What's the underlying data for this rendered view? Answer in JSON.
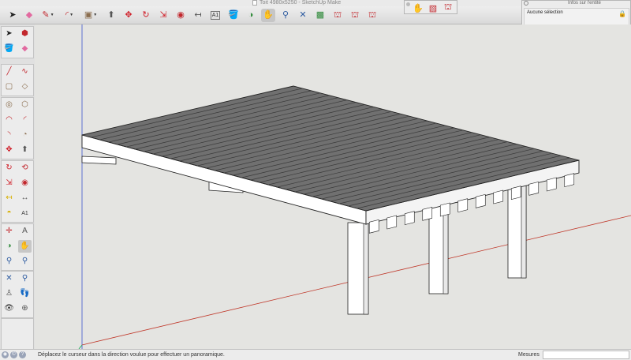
{
  "window": {
    "title": "Toit 4980x5250 - SketchUp Make"
  },
  "toolbar": {
    "tools": [
      {
        "name": "select-arrow-icon",
        "glyph": "➤",
        "color": "#222222"
      },
      {
        "name": "eraser-icon",
        "glyph": "◆",
        "color": "#e26aa0"
      },
      {
        "name": "pencil-line-icon",
        "glyph": "✎",
        "color": "#c2272d",
        "dropdown": true
      },
      {
        "name": "arc-icon",
        "glyph": "◜",
        "color": "#c2272d",
        "dropdown": true
      },
      {
        "name": "rectangle-shape-icon",
        "glyph": "▣",
        "color": "#8a6d4e",
        "dropdown": true
      },
      {
        "name": "push-pull-icon",
        "glyph": "⬆",
        "color": "#555555"
      },
      {
        "name": "move-icon",
        "glyph": "✥",
        "color": "#d0202a"
      },
      {
        "name": "rotate-icon",
        "glyph": "↻",
        "color": "#d0202a"
      },
      {
        "name": "scale-icon",
        "glyph": "⇲",
        "color": "#d0202a"
      },
      {
        "name": "offset-icon",
        "glyph": "◉",
        "color": "#c2272d"
      },
      {
        "name": "tape-measure-icon",
        "glyph": "↤",
        "color": "#555555"
      },
      {
        "name": "text-tool-icon",
        "glyph": "A1",
        "color": "#333333"
      },
      {
        "name": "paint-bucket-icon",
        "glyph": "🪣",
        "color": "#d8b000"
      },
      {
        "name": "orbit-icon",
        "glyph": "◑",
        "color": "#2f8a3a"
      },
      {
        "name": "pan-hand-icon",
        "glyph": "✋",
        "color": "#333333"
      },
      {
        "name": "zoom-icon",
        "glyph": "⚲",
        "color": "#2c5aa0"
      },
      {
        "name": "zoom-window-icon",
        "glyph": "✕",
        "color": "#2c5aa0"
      },
      {
        "name": "zoom-extents-icon",
        "glyph": "▩",
        "color": "#2f8a3a"
      },
      {
        "name": "warehouse-icon",
        "glyph": "⛫",
        "color": "#c2272d"
      },
      {
        "name": "share-model-icon",
        "glyph": "⛫",
        "color": "#c2272d"
      },
      {
        "name": "extension-warehouse-icon",
        "glyph": "⛫",
        "color": "#c2272d"
      }
    ]
  },
  "floating_toolbar": {
    "tools": [
      {
        "name": "sandbox-from-contours-icon",
        "glyph": "✋",
        "color": "#555555"
      },
      {
        "name": "sandbox-smoove-icon",
        "glyph": "▧",
        "color": "#c2272d"
      },
      {
        "name": "sandbox-stamp-icon",
        "glyph": "⛫",
        "color": "#c2272d"
      }
    ]
  },
  "entity_info": {
    "title": "Infos sur l'entité",
    "selection_text": "Aucune sélection",
    "lock_icon": "lock-icon"
  },
  "tool_palette": {
    "tools": [
      {
        "name": "select-arrow-icon",
        "glyph": "➤",
        "color": "#222222"
      },
      {
        "name": "make-component-icon",
        "glyph": "⬢",
        "color": "#c2272d"
      },
      {
        "name": "paint-bucket-icon",
        "glyph": "🪣",
        "color": "#d8b000"
      },
      {
        "name": "eraser-icon",
        "glyph": "◆",
        "color": "#e26aa0"
      },
      {
        "name": "line-icon",
        "glyph": "╱",
        "color": "#c2272d"
      },
      {
        "name": "freehand-icon",
        "glyph": "∿",
        "color": "#c2272d"
      },
      {
        "name": "rectangle-icon",
        "glyph": "▢",
        "color": "#8a6d4e"
      },
      {
        "name": "rotated-rectangle-icon",
        "glyph": "◇",
        "color": "#8a6d4e"
      },
      {
        "name": "circle-icon",
        "glyph": "◎",
        "color": "#8a6d4e"
      },
      {
        "name": "polygon-icon",
        "glyph": "⬡",
        "color": "#8a6d4e"
      },
      {
        "name": "arc-icon",
        "glyph": "◠",
        "color": "#c2272d"
      },
      {
        "name": "two-point-arc-icon",
        "glyph": "◜",
        "color": "#c2272d"
      },
      {
        "name": "three-point-arc-icon",
        "glyph": "◝",
        "color": "#c2272d"
      },
      {
        "name": "pie-icon",
        "glyph": "◔",
        "color": "#8a6d4e"
      },
      {
        "name": "move-icon",
        "glyph": "✥",
        "color": "#d0202a"
      },
      {
        "name": "push-pull-icon",
        "glyph": "⬆",
        "color": "#555555"
      },
      {
        "name": "rotate-icon",
        "glyph": "↻",
        "color": "#d0202a"
      },
      {
        "name": "follow-me-icon",
        "glyph": "⟲",
        "color": "#c2272d"
      },
      {
        "name": "scale-icon",
        "glyph": "⇲",
        "color": "#d0202a"
      },
      {
        "name": "offset-icon",
        "glyph": "◉",
        "color": "#c2272d"
      },
      {
        "name": "tape-measure-icon",
        "glyph": "↤",
        "color": "#d8b000"
      },
      {
        "name": "dimension-icon",
        "glyph": "↔",
        "color": "#555555"
      },
      {
        "name": "protractor-icon",
        "glyph": "◓",
        "color": "#d8b000"
      },
      {
        "name": "text-icon",
        "glyph": "A1",
        "color": "#333333"
      },
      {
        "name": "axes-icon",
        "glyph": "✛",
        "color": "#c2272d"
      },
      {
        "name": "3d-text-icon",
        "glyph": "A",
        "color": "#555555"
      },
      {
        "name": "orbit-icon",
        "glyph": "◑",
        "color": "#2f8a3a"
      },
      {
        "name": "pan-hand-icon",
        "glyph": "✋",
        "color": "#555555"
      },
      {
        "name": "zoom-icon",
        "glyph": "⚲",
        "color": "#2c5aa0"
      },
      {
        "name": "zoom-window-icon",
        "glyph": "⚲",
        "color": "#2c5aa0"
      },
      {
        "name": "zoom-extents-icon",
        "glyph": "✕",
        "color": "#2c5aa0"
      },
      {
        "name": "previous-view-icon",
        "glyph": "⚲",
        "color": "#2c5aa0"
      },
      {
        "name": "position-camera-icon",
        "glyph": "♙",
        "color": "#555555"
      },
      {
        "name": "walk-icon",
        "glyph": "👣",
        "color": "#333333"
      },
      {
        "name": "look-around-icon",
        "glyph": "👁",
        "color": "#333333"
      },
      {
        "name": "section-plane-icon",
        "glyph": "⊕",
        "color": "#555555"
      }
    ]
  },
  "status_bar": {
    "message": "Déplacez le curseur dans la direction voulue pour effectuer un panoramique.",
    "measures_label": "Mesures",
    "measures_value": ""
  },
  "colors": {
    "sky": "#e4e4e1",
    "deck_top": "#6e6e6e",
    "slat_line": "#3a3a3a",
    "beam": "#ffffff",
    "edge": "#222222",
    "axis_red": "#c0392b",
    "axis_green": "#27ae60",
    "axis_blue": "#5b6fd1"
  }
}
